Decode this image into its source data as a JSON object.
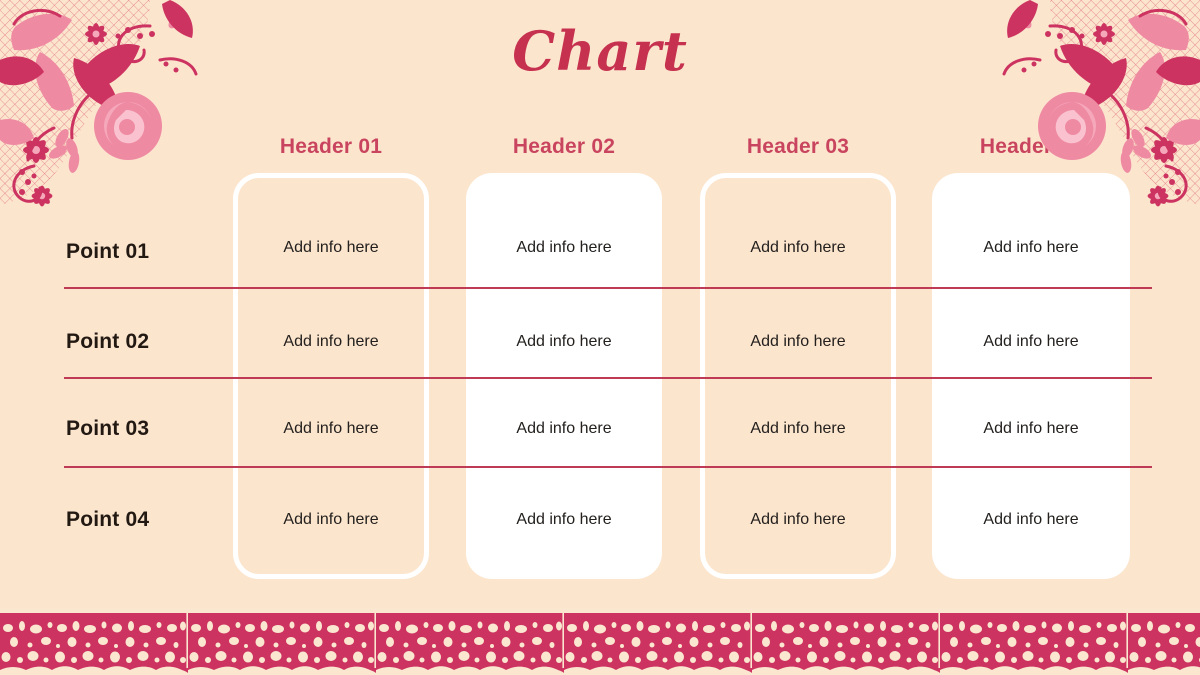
{
  "slide": {
    "title": "Chart",
    "background_color": "#fce5cd",
    "accent_color": "#c6314f",
    "header_color": "#c9455f",
    "separator_color": "#bf3a55",
    "card_white": "#ffffff",
    "text_color": "#231913"
  },
  "table": {
    "headers": [
      {
        "label": "Header 01"
      },
      {
        "label": "Header 02"
      },
      {
        "label": "Header 03"
      },
      {
        "label": "Header 04"
      }
    ],
    "rows": [
      {
        "point": "Point 01",
        "cells": [
          "Add info here",
          "Add info here",
          "Add info here",
          "Add info here"
        ]
      },
      {
        "point": "Point 02",
        "cells": [
          "Add info here",
          "Add info here",
          "Add info here",
          "Add info here"
        ]
      },
      {
        "point": "Point 03",
        "cells": [
          "Add info here",
          "Add info here",
          "Add info here",
          "Add info here"
        ]
      },
      {
        "point": "Point 04",
        "cells": [
          "Add info here",
          "Add info here",
          "Add info here",
          "Add info here"
        ]
      }
    ]
  },
  "decorations": {
    "corner_top_left": "floral-lace-corner-icon",
    "corner_top_right": "floral-lace-corner-icon",
    "bottom_border": "lace-band-icon",
    "lace_color": "#cc3361",
    "lace_hole_color": "#fbe6cf"
  }
}
